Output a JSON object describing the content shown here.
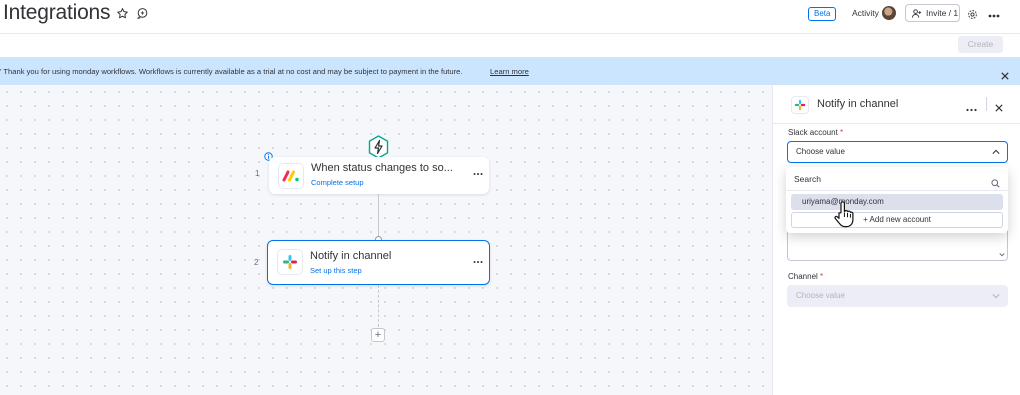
{
  "header": {
    "title": "Integrations",
    "beta_label": "Beta",
    "activity_label": "Activity",
    "invite_label": "Invite / 1",
    "icons": [
      "star-icon",
      "chat-icon",
      "person-add-icon",
      "gear-icon",
      "more-icon"
    ]
  },
  "toolbar": {
    "create_label": "Create"
  },
  "banner": {
    "text": "' Thank you for using monday workflows. Workflows is currently available as a trial at no cost and may be subject to payment in the future.",
    "link": "Learn more",
    "background": "#cce5ff"
  },
  "workflow": {
    "steps": [
      {
        "number": "1",
        "title": "When status changes to so...",
        "subtitle": "Complete setup",
        "icon": "monday-logo-icon"
      },
      {
        "number": "2",
        "title": "Notify in channel",
        "subtitle": "Set up this step",
        "icon": "slack-logo-icon"
      }
    ],
    "add_label": "+"
  },
  "panel": {
    "title": "Notify in channel",
    "slack_account": {
      "label": "Slack account",
      "required": "*",
      "placeholder": "Choose value"
    },
    "channel": {
      "label": "Channel",
      "required": "*",
      "placeholder": "Choose value"
    }
  },
  "dropdown": {
    "search_placeholder": "Search",
    "options": [
      "uriyama@monday.com"
    ],
    "add_label": "+ Add new account"
  },
  "colors": {
    "accent": "#0073ea",
    "required": "#d83a52",
    "option_hover": "#dcdfec"
  }
}
